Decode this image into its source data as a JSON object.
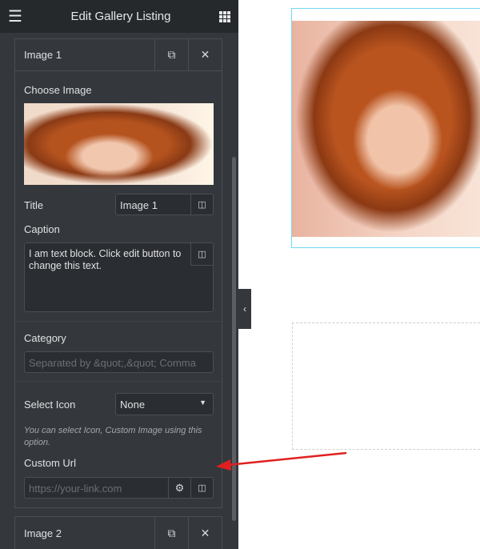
{
  "header": {
    "title": "Edit Gallery Listing",
    "menu_icon": "hamburger-icon",
    "apps_icon": "grid-icon"
  },
  "items": [
    {
      "label": "Image 1",
      "choose_image_label": "Choose Image",
      "title_label": "Title",
      "title_value": "Image 1",
      "caption_label": "Caption",
      "caption_value": "I am text block. Click edit button to change this text.",
      "category_label": "Category",
      "category_placeholder": "Separated by &quot;,&quot; Comma",
      "select_icon_label": "Select Icon",
      "select_icon_value": "None",
      "select_icon_hint": "You can select Icon, Custom Image using this option.",
      "custom_url_label": "Custom Url",
      "custom_url_placeholder": "https://your-link.com"
    },
    {
      "label": "Image 2"
    }
  ],
  "colors": {
    "header": "#26292c",
    "panel": "#34383c",
    "annotation_arrow": "#e02020",
    "selection_border": "#71d7f7"
  }
}
